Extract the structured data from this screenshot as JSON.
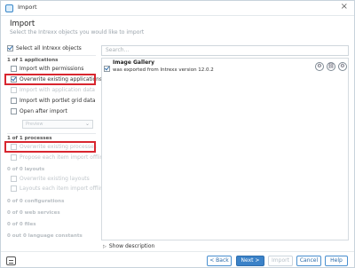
{
  "window": {
    "title": "Import",
    "close_glyph": "×"
  },
  "header": {
    "title": "Import",
    "subtitle": "Select the Intrexx objects you would like to import"
  },
  "left": {
    "select_all": {
      "label": "Select all Intrexx objects",
      "checked": true
    },
    "applications_section": "1 of 1 applications",
    "options": [
      {
        "label": "Import with permissions",
        "checked": false,
        "enabled": true
      },
      {
        "label": "Overwrite existing applications",
        "checked": true,
        "enabled": true
      },
      {
        "label": "Import with application data",
        "checked": false,
        "enabled": false
      },
      {
        "label": "Import with portlet grid data",
        "checked": false,
        "enabled": true
      },
      {
        "label": "Open after import",
        "checked": false,
        "enabled": true
      }
    ],
    "open_select_value": "Preview",
    "processes_section": "1 of 1 processes",
    "process_options": [
      {
        "label": "Overwrite existing processes",
        "checked": false,
        "enabled": false
      },
      {
        "label": "Propose each item import offline",
        "checked": false,
        "enabled": false
      }
    ],
    "layouts_section": "0 of 0 layouts",
    "layout_options": [
      {
        "label": "Overwrite existing layouts",
        "checked": false,
        "enabled": false
      },
      {
        "label": "Layouts each item import offline",
        "checked": false,
        "enabled": false
      }
    ],
    "configurations_section": "0 of 0 configurations",
    "web_services_section": "0 of 0 web services",
    "files_section": "0 of 0 files",
    "language_section": "0 out 0 language constants"
  },
  "right": {
    "search_placeholder": "Search...",
    "items": [
      {
        "name": "Image Gallery",
        "description": "was exported from Intrexx version 12.0.2",
        "checked": true
      }
    ],
    "item_buttons": [
      "gear-icon",
      "link-icon",
      "settings-icon"
    ],
    "item_button_glyphs": [
      "⚙",
      "⛓",
      "⚙"
    ],
    "show_description": "Show description"
  },
  "footer": {
    "back": "< Back",
    "next": "Next >",
    "import": "Import",
    "cancel": "Cancel",
    "help": "Help"
  }
}
